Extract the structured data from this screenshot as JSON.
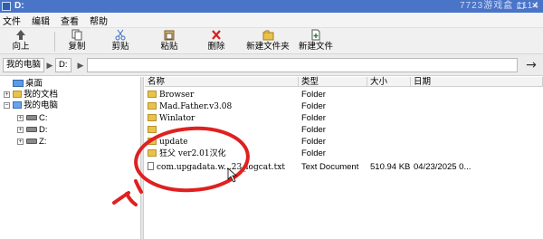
{
  "window": {
    "title": "D:",
    "watermark": "7723游戏盒 1114",
    "controls": {
      "minimize": "–",
      "maximize": "□",
      "close": "✕"
    }
  },
  "menu": {
    "items": [
      "文件",
      "编辑",
      "查看",
      "帮助"
    ]
  },
  "toolbar": {
    "up": {
      "label": "向上",
      "icon": "up-arrow-icon"
    },
    "copy": {
      "label": "复制",
      "icon": "copy-icon"
    },
    "cut": {
      "label": "剪贴",
      "icon": "scissors-icon"
    },
    "paste": {
      "label": "粘贴",
      "icon": "paste-icon"
    },
    "delete": {
      "label": "删除",
      "icon": "delete-x-icon"
    },
    "new_folder": {
      "label": "新建文件夹",
      "icon": "new-folder-icon"
    },
    "new_file": {
      "label": "新建文件",
      "icon": "new-file-icon"
    }
  },
  "address": {
    "crumbs": [
      "我的电脑",
      "D:"
    ]
  },
  "tree": {
    "desktop": "桌面",
    "documents": "我的文档",
    "computer": "我的电脑",
    "drives": [
      "C:",
      "D:",
      "Z:"
    ]
  },
  "filelist": {
    "columns": [
      "名称",
      "类型",
      "大小",
      "日期"
    ],
    "rows": [
      {
        "name": "Browser",
        "type": "Folder",
        "size": "",
        "date": ""
      },
      {
        "name": "Mad.Father.v3.08",
        "type": "Folder",
        "size": "",
        "date": ""
      },
      {
        "name": "Winlator",
        "type": "Folder",
        "size": "",
        "date": ""
      },
      {
        "name": "",
        "type": "Folder",
        "size": "",
        "date": ""
      },
      {
        "name": "update",
        "type": "Folder",
        "size": "",
        "date": ""
      },
      {
        "name": "狂父 ver2.01汉化",
        "type": "Folder",
        "size": "",
        "date": ""
      },
      {
        "name": "com.upgadata.w...23_logcat.txt",
        "type": "Text Document",
        "size": "510.94 KB",
        "date": "04/23/2025 0..."
      }
    ]
  },
  "colors": {
    "annotation": "#e02020",
    "titlebar": "#4a74c8",
    "folder": "#e8c24a"
  }
}
